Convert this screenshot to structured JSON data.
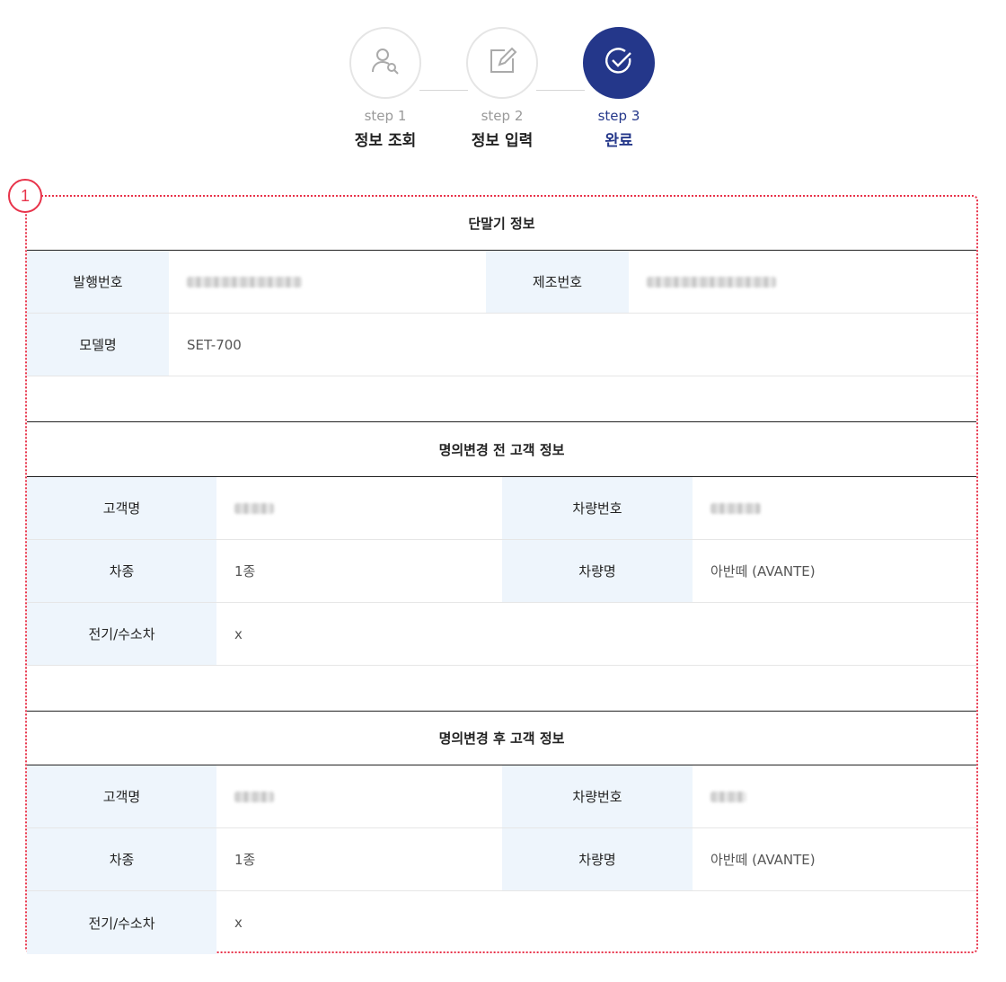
{
  "stepper": {
    "steps": [
      {
        "num": "step 1",
        "label": "정보 조회",
        "icon": "user-search-icon"
      },
      {
        "num": "step 2",
        "label": "정보 입력",
        "icon": "edit-icon"
      },
      {
        "num": "step 3",
        "label": "완료",
        "icon": "check-circle-icon"
      }
    ],
    "active_color": "#24378a"
  },
  "annotation": {
    "badge": "1",
    "color": "#e8334a"
  },
  "device_info": {
    "title": "단말기 정보",
    "issue_no_label": "발행번호",
    "serial_no_label": "제조번호",
    "model_label": "모델명",
    "model_value": "SET-700"
  },
  "before_info": {
    "title": "명의변경 전 고객 정보",
    "customer_label": "고객명",
    "plate_label": "차량번호",
    "class_label": "차종",
    "class_value": "1종",
    "car_name_label": "차량명",
    "car_name_value": "아반떼 (AVANTE)",
    "ev_label": "전기/수소차",
    "ev_value": "x"
  },
  "after_info": {
    "title": "명의변경 후 고객 정보",
    "customer_label": "고객명",
    "plate_label": "차량번호",
    "class_label": "차종",
    "class_value": "1종",
    "car_name_label": "차량명",
    "car_name_value": "아반떼 (AVANTE)",
    "ev_label": "전기/수소차",
    "ev_value": "x"
  },
  "colors": {
    "header_bg": "#eef5fc",
    "accent": "#24378a"
  }
}
